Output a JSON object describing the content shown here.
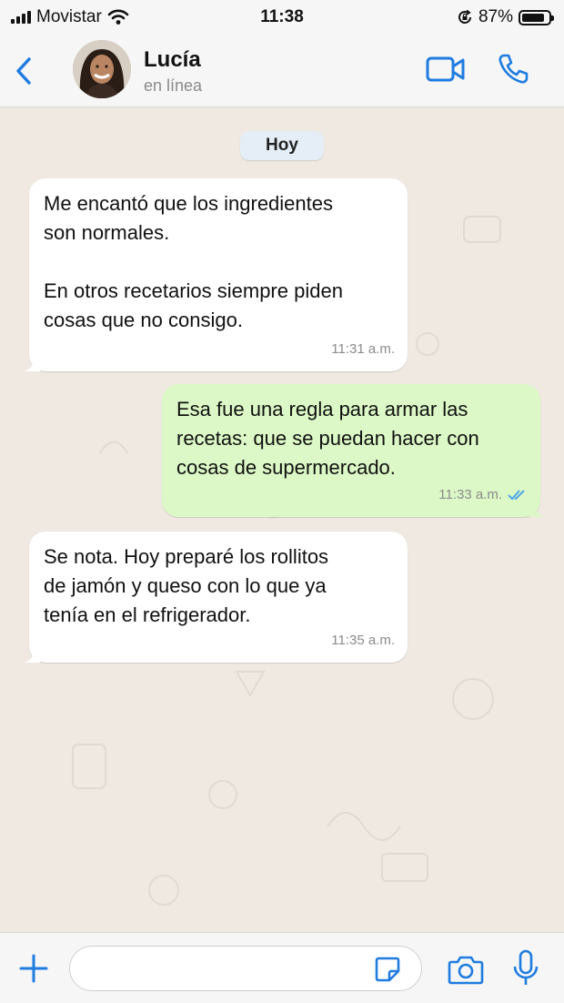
{
  "status_bar": {
    "carrier": "Movistar",
    "time": "11:38",
    "battery_percent": "87%",
    "battery_level": 0.87
  },
  "header": {
    "contact_name": "Lucía",
    "contact_status": "en línea"
  },
  "chat": {
    "date_label": "Hoy",
    "messages": [
      {
        "direction": "incoming",
        "text": "Me encantó que los ingredientes\nson normales.\n\nEn otros recetarios siempre piden\ncosas que no consigo.",
        "time": "11:31 a.m."
      },
      {
        "direction": "outgoing",
        "text": "Esa fue una regla para armar las\nrecetas: que se puedan hacer con\ncosas de supermercado.",
        "time": "11:33 a.m.",
        "read": true
      },
      {
        "direction": "incoming",
        "text": "Se nota. Hoy preparé los rollitos\nde jamón y queso con lo que ya\ntenía en el refrigerador.",
        "time": "11:35 a.m."
      }
    ]
  },
  "input_bar": {
    "value": "",
    "placeholder": ""
  },
  "colors": {
    "accent": "#1f7ce0",
    "incoming_bubble": "#ffffff",
    "outgoing_bubble": "#dcf8c6",
    "read_ticks": "#4fa6e6",
    "wallpaper": "#efe9e1"
  },
  "icons": [
    "signal-icon",
    "wifi-icon",
    "rotation-lock-icon",
    "battery-icon",
    "back-chevron-icon",
    "video-camera-icon",
    "phone-icon",
    "plus-icon",
    "sticker-icon",
    "camera-icon",
    "microphone-icon",
    "double-check-icon"
  ]
}
